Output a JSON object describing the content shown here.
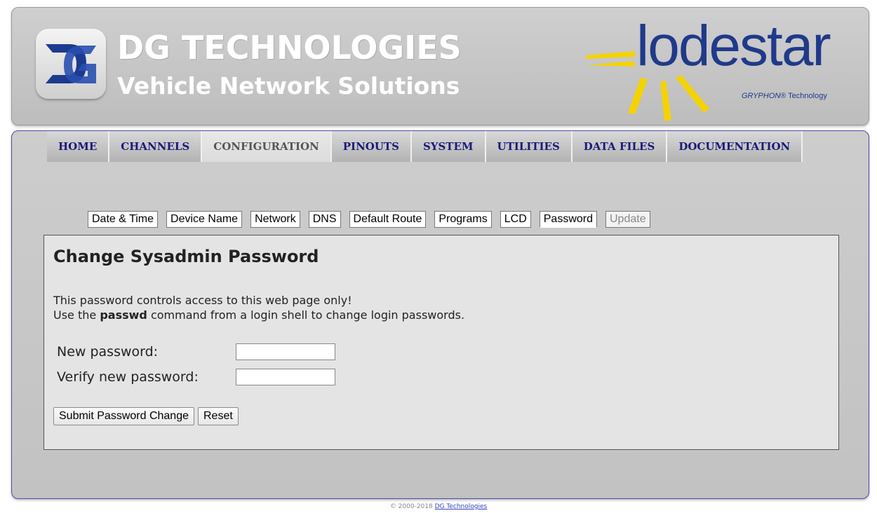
{
  "header": {
    "brand_title": "DG TECHNOLOGIES",
    "brand_subtitle": "Vehicle Network Solutions",
    "product_name": "lodestar",
    "product_tag_italic": "GRYPHON",
    "product_tag_rest": "® Technology",
    "brand_color": "#1f3a8a",
    "ray_color": "#f5d300"
  },
  "nav": {
    "items": [
      {
        "label": "HOME",
        "active": false
      },
      {
        "label": "CHANNELS",
        "active": false
      },
      {
        "label": "CONFIGURATION",
        "active": true
      },
      {
        "label": "PINOUTS",
        "active": false
      },
      {
        "label": "SYSTEM",
        "active": false
      },
      {
        "label": "UTILITIES",
        "active": false
      },
      {
        "label": "DATA FILES",
        "active": false
      },
      {
        "label": "DOCUMENTATION",
        "active": false
      }
    ]
  },
  "subtabs": {
    "items": [
      {
        "label": "Date & Time"
      },
      {
        "label": "Device Name"
      },
      {
        "label": "Network"
      },
      {
        "label": "DNS"
      },
      {
        "label": "Default Route"
      },
      {
        "label": "Programs"
      },
      {
        "label": "LCD"
      },
      {
        "label": "Password",
        "active": true
      },
      {
        "label": "Update",
        "disabled": true
      }
    ]
  },
  "content": {
    "title": "Change Sysadmin Password",
    "line1": "This password controls access to this web page only!",
    "line2_prefix": "Use the ",
    "line2_bold": "passwd",
    "line2_suffix": " command from a login shell to change login passwords.",
    "new_password_label": "New password:",
    "new_password_value": "",
    "verify_password_label": "Verify new password:",
    "verify_password_value": "",
    "submit_label": "Submit Password Change",
    "reset_label": "Reset"
  },
  "footer": {
    "copyright": "© 2000-2018 ",
    "link_text": "DG Technologies"
  }
}
